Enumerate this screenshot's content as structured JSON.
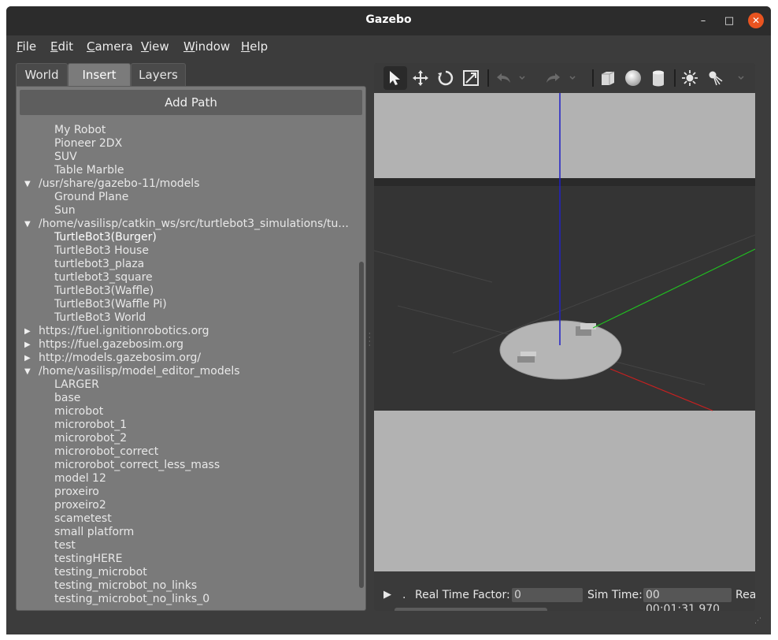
{
  "window": {
    "title": "Gazebo",
    "controls": {
      "minimize": "–",
      "maximize": "□",
      "close": "✕"
    }
  },
  "menubar": [
    {
      "first": "F",
      "rest": "ile"
    },
    {
      "first": "E",
      "rest": "dit"
    },
    {
      "first": "C",
      "rest": "amera"
    },
    {
      "first": "V",
      "rest": "iew"
    },
    {
      "first": "W",
      "rest": "indow"
    },
    {
      "first": "H",
      "rest": "elp"
    }
  ],
  "left_panel": {
    "tabs": [
      "World",
      "Insert",
      "Layers"
    ],
    "active_tab": "Insert",
    "add_path_label": "Add Path",
    "tree": [
      {
        "label": "My Robot",
        "level": 1
      },
      {
        "label": "Pioneer 2DX",
        "level": 1
      },
      {
        "label": "SUV",
        "level": 1
      },
      {
        "label": "Table Marble",
        "level": 1
      },
      {
        "label": "/usr/share/gazebo-11/models",
        "level": 0,
        "expanded": true
      },
      {
        "label": "Ground Plane",
        "level": 1
      },
      {
        "label": "Sun",
        "level": 1
      },
      {
        "label": "/home/vasilisp/catkin_ws/src/turtlebot3_simulations/tu...",
        "level": 0,
        "expanded": true
      },
      {
        "label": "TurtleBot3(Burger)",
        "level": 1,
        "selected": true
      },
      {
        "label": "TurtleBot3 House",
        "level": 1
      },
      {
        "label": "turtlebot3_plaza",
        "level": 1
      },
      {
        "label": "turtlebot3_square",
        "level": 1
      },
      {
        "label": "TurtleBot3(Waffle)",
        "level": 1
      },
      {
        "label": "TurtleBot3(Waffle Pi)",
        "level": 1
      },
      {
        "label": "TurtleBot3 World",
        "level": 1
      },
      {
        "label": "https://fuel.ignitionrobotics.org",
        "level": 0,
        "expanded": false
      },
      {
        "label": "https://fuel.gazebosim.org",
        "level": 0,
        "expanded": false
      },
      {
        "label": "http://models.gazebosim.org/",
        "level": 0,
        "expanded": false
      },
      {
        "label": "/home/vasilisp/model_editor_models",
        "level": 0,
        "expanded": true
      },
      {
        "label": "LARGER",
        "level": 1
      },
      {
        "label": "base",
        "level": 1
      },
      {
        "label": "microbot",
        "level": 1
      },
      {
        "label": "microrobot_1",
        "level": 1
      },
      {
        "label": "microrobot_2",
        "level": 1
      },
      {
        "label": "microrobot_correct",
        "level": 1
      },
      {
        "label": "microrobot_correct_less_mass",
        "level": 1
      },
      {
        "label": "model 12",
        "level": 1
      },
      {
        "label": "proxeiro",
        "level": 1
      },
      {
        "label": "proxeiro2",
        "level": 1
      },
      {
        "label": "scametest",
        "level": 1
      },
      {
        "label": "small platform",
        "level": 1
      },
      {
        "label": "test",
        "level": 1
      },
      {
        "label": "testingHERE",
        "level": 1
      },
      {
        "label": "testing_microbot",
        "level": 1
      },
      {
        "label": "testing_microbot_no_links",
        "level": 1
      },
      {
        "label": "testing_microbot_no_links_0",
        "level": 1
      }
    ]
  },
  "toolbar": {
    "tools": [
      "select-arrow-icon",
      "translate-icon",
      "rotate-icon",
      "scale-icon",
      "undo-icon",
      "redo-icon",
      "box-shape-icon",
      "sphere-shape-icon",
      "cylinder-shape-icon",
      "point-light-icon",
      "spot-light-icon"
    ],
    "active_tool": "select-arrow-icon"
  },
  "statusbar": {
    "play_symbol": "▶",
    "dot": ".",
    "rtf_label": "Real Time Factor:",
    "rtf_value": "0",
    "sim_time_label": "Sim Time:",
    "sim_time_value": "00 00:01:31.970",
    "real_time_label_truncated": "Rea"
  },
  "colors": {
    "sky": "#b2b2b2",
    "ground": "#343434",
    "z_axis": "#2020c8",
    "x_axis": "#c82020",
    "y_axis": "#20c020",
    "close_button": "#e95420"
  }
}
